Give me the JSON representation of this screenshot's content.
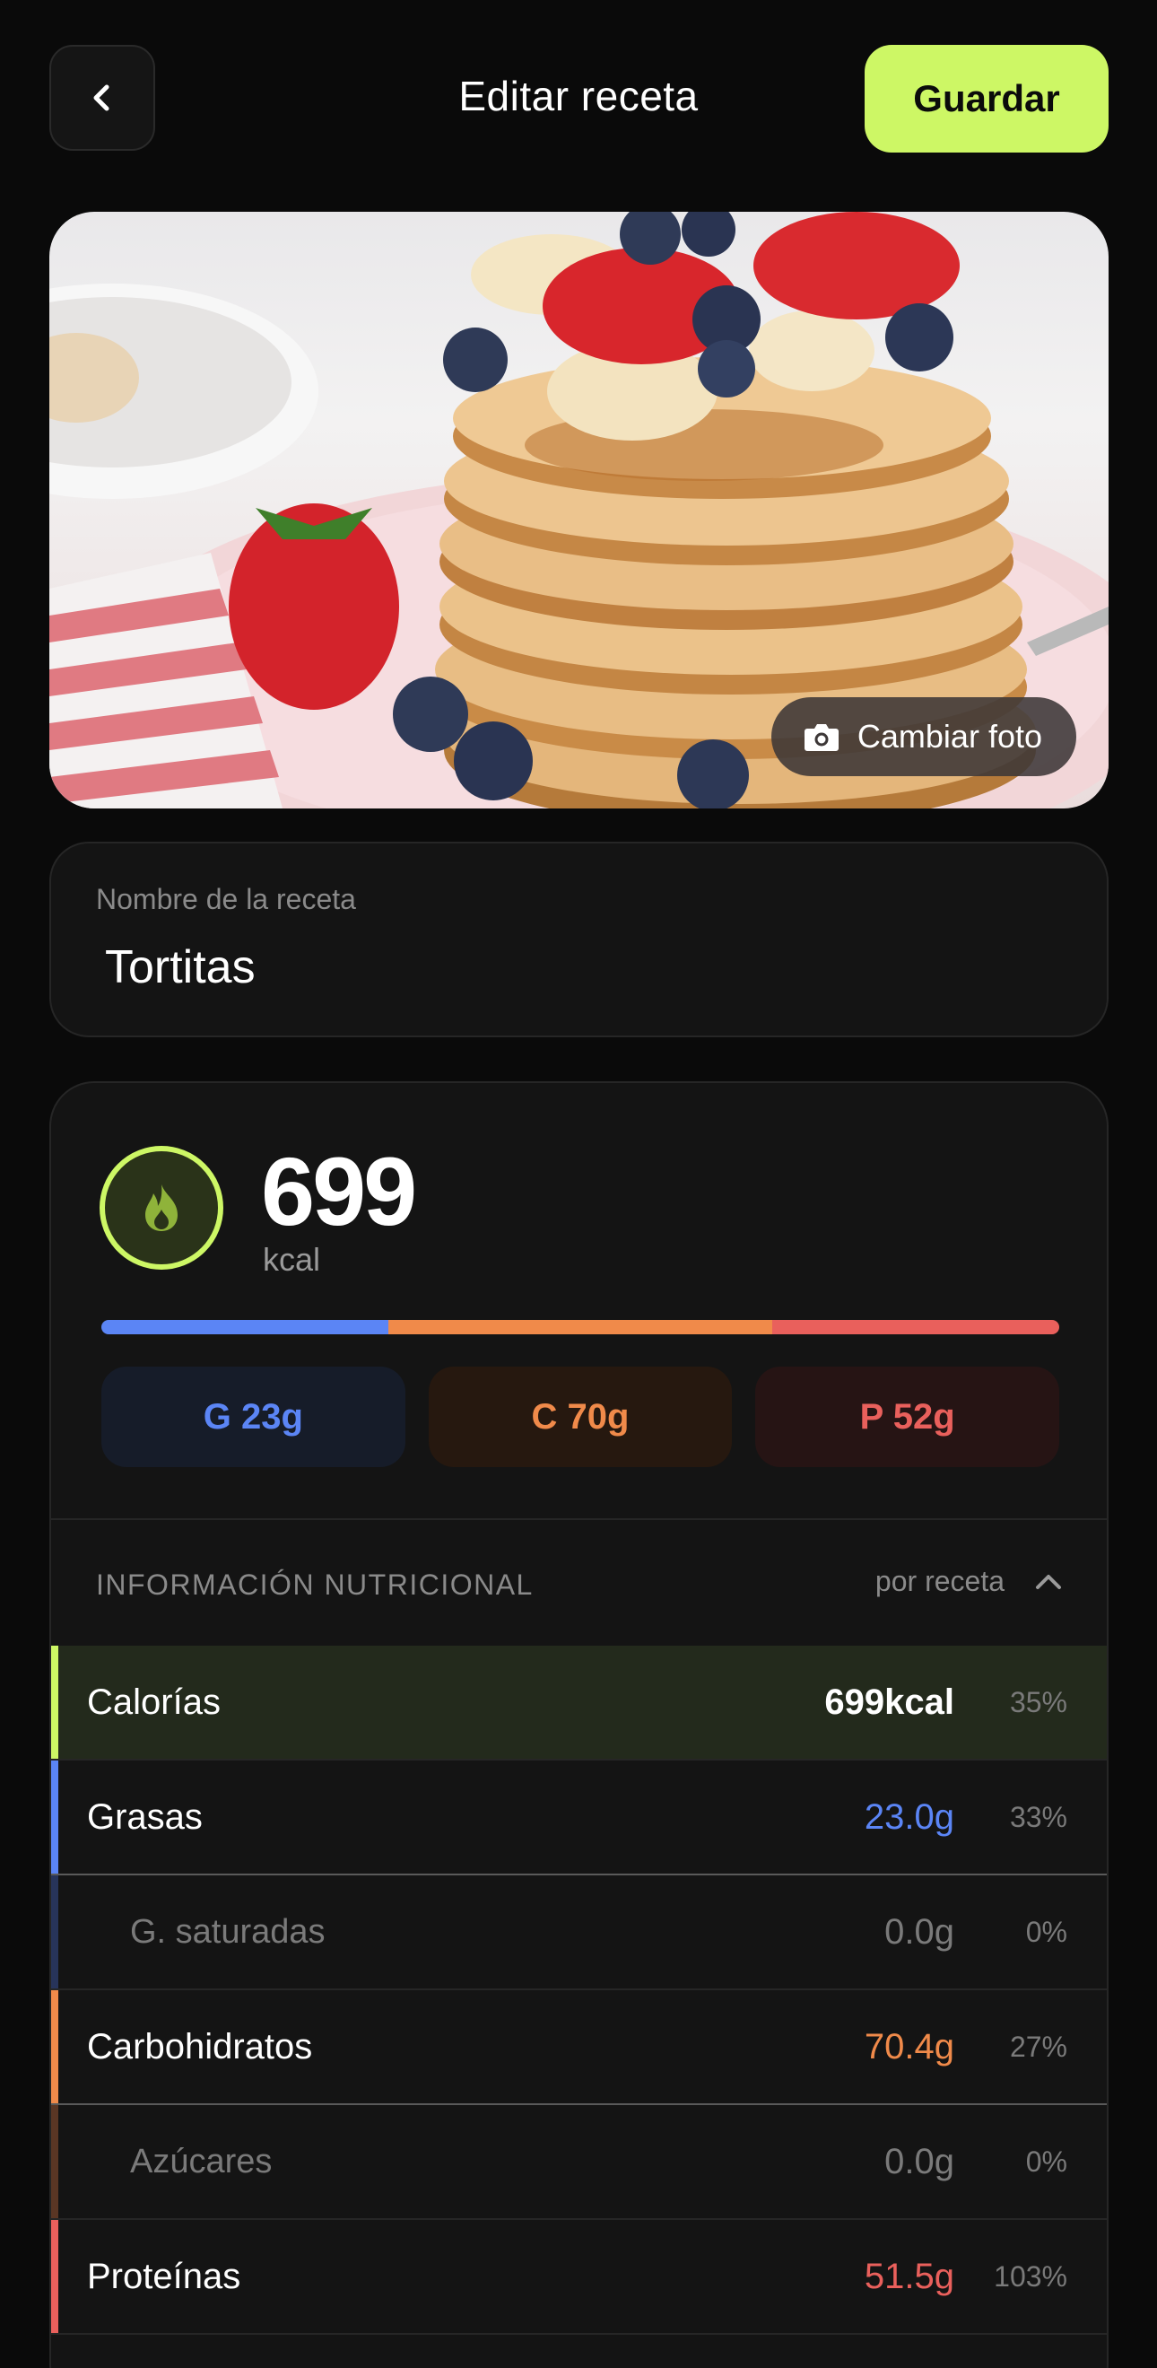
{
  "header": {
    "title": "Editar receta",
    "save_label": "Guardar"
  },
  "photo": {
    "change_label": "Cambiar foto"
  },
  "recipe": {
    "name_label": "Nombre de la receta",
    "name_value": "Tortitas"
  },
  "summary": {
    "kcal": "699",
    "kcal_unit": "kcal",
    "bar": [
      {
        "macro": "fat",
        "fraction": 0.3,
        "color": "#5b85f5"
      },
      {
        "macro": "carbs",
        "fraction": 0.4,
        "color": "#f08a4a"
      },
      {
        "macro": "protein",
        "fraction": 0.3,
        "color": "#e9605c"
      }
    ],
    "chips": [
      {
        "label": "G 23g",
        "color": "#5b85f5",
        "bg": "#161c29"
      },
      {
        "label": "C 70g",
        "color": "#f08a4a",
        "bg": "#26180f"
      },
      {
        "label": "P 52g",
        "color": "#e9605c",
        "bg": "#261414"
      }
    ]
  },
  "nutrition": {
    "title": "INFORMACIÓN NUTRICIONAL",
    "per_label": "por receta",
    "rows": [
      {
        "label": "Calorías",
        "value": "699kcal",
        "pct": "35%",
        "accent": "#cdf765",
        "value_color": "#ffffff"
      },
      {
        "label": "Grasas",
        "value": "23.0g",
        "pct": "33%",
        "accent": "#5b85f5",
        "value_color": "#5b85f5"
      },
      {
        "label": "G. saturadas",
        "value": "0.0g",
        "pct": "0%",
        "accent": "#27345a",
        "value_color": "#7a7a7a"
      },
      {
        "label": "Carbohidratos",
        "value": "70.4g",
        "pct": "27%",
        "accent": "#f08a4a",
        "value_color": "#f08a4a"
      },
      {
        "label": "Azúcares",
        "value": "0.0g",
        "pct": "0%",
        "accent": "#5a3624",
        "value_color": "#7a7a7a"
      },
      {
        "label": "Proteínas",
        "value": "51.5g",
        "pct": "103%",
        "accent": "#e9605c",
        "value_color": "#e9605c"
      }
    ]
  }
}
